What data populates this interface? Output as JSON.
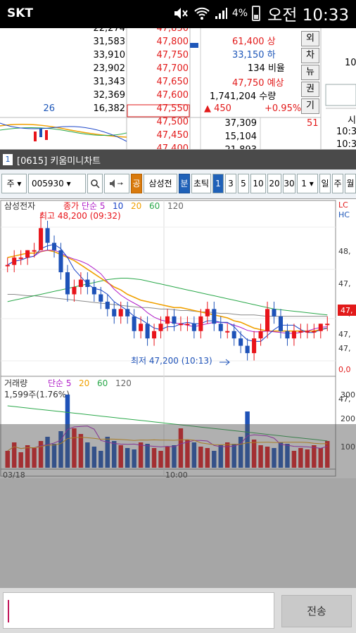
{
  "status_bar": {
    "carrier": "SKT",
    "battery": "4%",
    "time": "오전 10:33"
  },
  "orderbook": {
    "rows": [
      {
        "count": "",
        "qty": "22,274",
        "price": "47,850"
      },
      {
        "count": "",
        "qty": "31,583",
        "price": "47,800"
      },
      {
        "count": "",
        "qty": "33,910",
        "price": "47,750"
      },
      {
        "count": "",
        "qty": "23,902",
        "price": "47,700"
      },
      {
        "count": "",
        "qty": "31,343",
        "price": "47,650"
      },
      {
        "count": "",
        "qty": "32,369",
        "price": "47,600"
      },
      {
        "count": "26",
        "qty": "16,382",
        "price": "47,550"
      },
      {
        "count": "",
        "qty": "",
        "price": "47,500"
      },
      {
        "count": "",
        "qty": "",
        "price": "47,450"
      },
      {
        "count": "",
        "qty": "",
        "price": "47,400"
      }
    ],
    "bid_qty": [
      "37,309",
      "15,104",
      "21,893"
    ],
    "info": {
      "upper_limit": "61,400 상",
      "lower_limit": "33,150 하",
      "ratio": "134 비율",
      "expected": "47,750 예상",
      "expected_vol": "1,741,204 수량",
      "change": "▲ 450",
      "change_pct": "+0.95%",
      "extra": "51"
    },
    "side_buttons": [
      "외",
      "차",
      "뉴",
      "권",
      "기"
    ],
    "right_partial": [
      "10",
      "시",
      "10:3",
      "10:3"
    ]
  },
  "mini_chart_window": {
    "window_number": "1",
    "title": "[0615] 키움미니차트",
    "toolbar": {
      "period_select": "주",
      "code": "005930",
      "search_icon": "search-icon",
      "sound_icon": "speaker-icon",
      "common_btn": "공",
      "stock_name": "삼성전",
      "minute_btn": "분",
      "tick_btn": "초틱",
      "intervals": [
        "1",
        "3",
        "5",
        "10",
        "20",
        "30"
      ],
      "interval_select": "1",
      "day_btn": "일",
      "week_btn": "주",
      "month_btn": "월"
    },
    "chart_data": [
      {
        "type": "line",
        "title": "삼성전자",
        "legend": [
          "종가",
          "단순 5",
          "10",
          "20",
          "60",
          "120"
        ],
        "annotations": {
          "high": "최고 48,200 (09:32)",
          "low": "최저 47,200 (10:13)"
        },
        "right_axis_partial": [
          "LC",
          "HC",
          "48,",
          "47,",
          "47,",
          "47,",
          "47,",
          "0,0",
          "47,"
        ],
        "current_price_tag": "47,",
        "x_ticks": [
          "03/18",
          "10:00"
        ],
        "colors": {
          "up": "#e8141a",
          "down": "#1e52b8",
          "ma5": "#1a44c8",
          "ma10": "#b01dc8",
          "ma20": "#f0a000",
          "ma60": "#2aa84a",
          "ma120": "#8a8a8a"
        },
        "candles": [
          [
            47850,
            47900,
            47800,
            47850
          ],
          [
            47850,
            47950,
            47800,
            47900
          ],
          [
            47900,
            47950,
            47850,
            47900
          ],
          [
            47900,
            47950,
            47850,
            47950
          ],
          [
            47950,
            48000,
            47900,
            47950
          ],
          [
            47950,
            48200,
            47950,
            48100
          ],
          [
            48100,
            48150,
            47950,
            48000
          ],
          [
            48000,
            48050,
            47900,
            47950
          ],
          [
            47950,
            48000,
            47750,
            47800
          ],
          [
            47800,
            47850,
            47600,
            47650
          ],
          [
            47650,
            47750,
            47600,
            47700
          ],
          [
            47700,
            47800,
            47650,
            47750
          ],
          [
            47750,
            47800,
            47650,
            47700
          ],
          [
            47700,
            47750,
            47600,
            47650
          ],
          [
            47650,
            47700,
            47550,
            47600
          ],
          [
            47600,
            47650,
            47500,
            47550
          ],
          [
            47550,
            47600,
            47450,
            47500
          ],
          [
            47500,
            47600,
            47450,
            47550
          ],
          [
            47550,
            47600,
            47450,
            47500
          ],
          [
            47500,
            47550,
            47350,
            47400
          ],
          [
            47400,
            47500,
            47350,
            47450
          ],
          [
            47450,
            47500,
            47300,
            47350
          ],
          [
            47350,
            47450,
            47300,
            47400
          ],
          [
            47400,
            47500,
            47350,
            47450
          ],
          [
            47450,
            47550,
            47400,
            47500
          ],
          [
            47500,
            47550,
            47400,
            47450
          ],
          [
            47450,
            47500,
            47400,
            47450
          ],
          [
            47450,
            47500,
            47400,
            47450
          ],
          [
            47450,
            47500,
            47350,
            47400
          ],
          [
            47400,
            47550,
            47350,
            47500
          ],
          [
            47500,
            47600,
            47450,
            47550
          ],
          [
            47550,
            47600,
            47400,
            47450
          ],
          [
            47450,
            47500,
            47350,
            47400
          ],
          [
            47400,
            47450,
            47350,
            47400
          ],
          [
            47400,
            47450,
            47300,
            47350
          ],
          [
            47350,
            47400,
            47250,
            47300
          ],
          [
            47300,
            47350,
            47200,
            47250
          ],
          [
            47250,
            47400,
            47200,
            47350
          ],
          [
            47350,
            47450,
            47300,
            47400
          ],
          [
            47400,
            47600,
            47350,
            47550
          ],
          [
            47550,
            47600,
            47450,
            47500
          ],
          [
            47500,
            47550,
            47350,
            47400
          ],
          [
            47400,
            47450,
            47300,
            47350
          ],
          [
            47350,
            47450,
            47300,
            47400
          ],
          [
            47400,
            47450,
            47350,
            47400
          ],
          [
            47400,
            47450,
            47350,
            47400
          ],
          [
            47400,
            47450,
            47350,
            47400
          ],
          [
            47400,
            47450,
            47350,
            47450
          ],
          [
            47450,
            47500,
            47400,
            47450
          ]
        ],
        "ma20": [
          47900,
          47910,
          47920,
          47930,
          47930,
          47940,
          47950,
          47940,
          47920,
          47900,
          47880,
          47850,
          47820,
          47790,
          47760,
          47730,
          47700,
          47680,
          47650,
          47630,
          47610,
          47600,
          47590,
          47580,
          47570,
          47560,
          47560,
          47550,
          47540,
          47530,
          47520,
          47510,
          47500,
          47490,
          47470,
          47460,
          47440,
          47420,
          47410,
          47400,
          47400,
          47400,
          47400,
          47400,
          47400,
          47400,
          47400,
          47410,
          47420
        ],
        "ma60": [
          47600,
          47610,
          47620,
          47630,
          47640,
          47650,
          47660,
          47670,
          47680,
          47690,
          47700,
          47710,
          47720,
          47730,
          47740,
          47750,
          47755,
          47760,
          47760,
          47755,
          47750,
          47740,
          47730,
          47720,
          47710,
          47700,
          47690,
          47680,
          47670,
          47660,
          47650,
          47640,
          47630,
          47620,
          47610,
          47600,
          47590,
          47580,
          47570,
          47560,
          47550,
          47545,
          47540,
          47535,
          47530,
          47525,
          47520,
          47515,
          47510
        ],
        "ma120": [
          47650,
          47650,
          47645,
          47640,
          47640,
          47635,
          47630,
          47625,
          47620,
          47615,
          47610,
          47605,
          47600,
          47595,
          47590,
          47585,
          47580,
          47575,
          47570,
          47565,
          47560,
          47560,
          47555,
          47550,
          47550,
          47545,
          47540,
          47540,
          47535,
          47530,
          47530,
          47525,
          47520,
          47520,
          47515,
          47510,
          47510,
          47510,
          47505,
          47500,
          47500,
          47500,
          47500,
          47500,
          47500,
          47500,
          47500,
          47500,
          47500
        ]
      },
      {
        "type": "bar",
        "title": "거래량",
        "legend": [
          "거래량",
          "단순 5",
          "20",
          "60",
          "120"
        ],
        "summary": "1,599주(1.76%)",
        "right_axis_partial": [
          "300",
          "200",
          "100"
        ],
        "values": [
          60,
          90,
          55,
          80,
          70,
          95,
          110,
          85,
          130,
          260,
          140,
          120,
          90,
          75,
          60,
          110,
          95,
          80,
          70,
          65,
          90,
          85,
          70,
          60,
          75,
          80,
          140,
          100,
          90,
          75,
          70,
          60,
          80,
          90,
          85,
          110,
          200,
          100,
          80,
          75,
          70,
          90,
          85,
          60,
          70,
          65,
          80,
          70,
          95
        ]
      }
    ]
  },
  "input_bar": {
    "text": "",
    "send_label": "전송"
  }
}
